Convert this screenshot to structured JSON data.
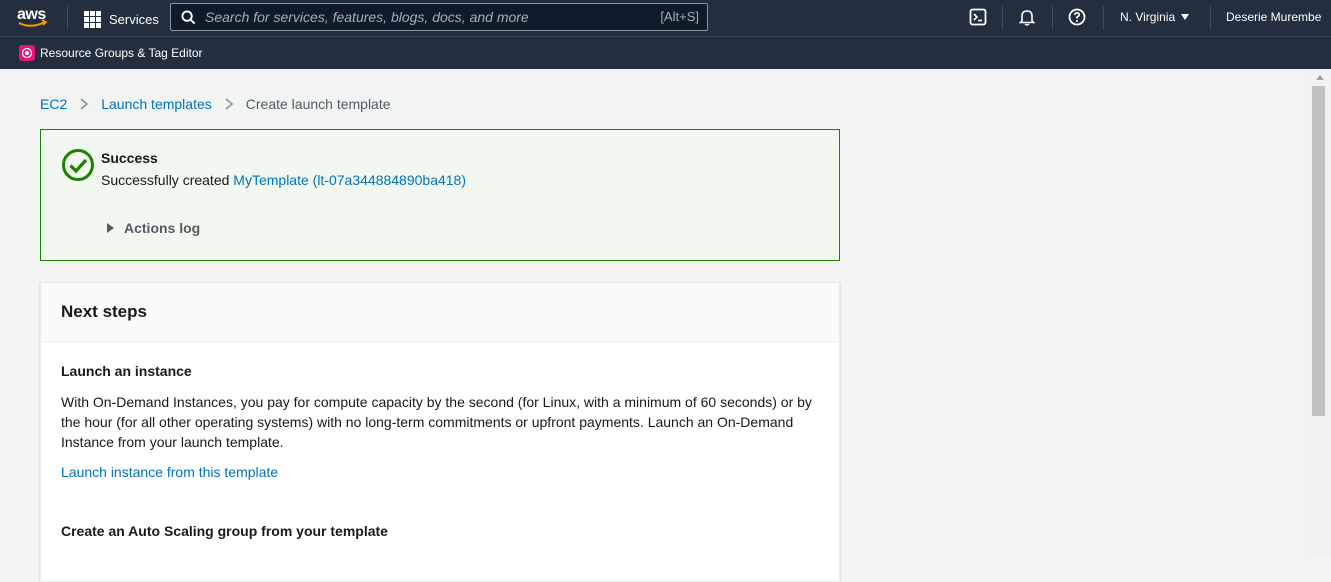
{
  "topbar": {
    "logo_text": "aws",
    "services_label": "Services",
    "search_placeholder": "Search for services, features, blogs, docs, and more",
    "search_shortcut": "[Alt+S]",
    "region": "N. Virginia",
    "user": "Deserie Murembe",
    "icons": [
      "cloudshell-icon",
      "bell-icon",
      "help-icon"
    ]
  },
  "subbar": {
    "resource_groups_label": "Resource Groups & Tag Editor"
  },
  "breadcrumb": {
    "items": [
      "EC2",
      "Launch templates",
      "Create launch template"
    ]
  },
  "alert": {
    "status": "success",
    "title": "Success",
    "message_prefix": "Successfully created",
    "template_link": "MyTemplate (lt-07a344884890ba418)",
    "actions_log_label": "Actions log",
    "color": "#1d8102"
  },
  "next_steps": {
    "title": "Next steps",
    "launch_title": "Launch an instance",
    "launch_body": "With On-Demand Instances, you pay for compute capacity by the second (for Linux, with a minimum of 60 seconds) or by the hour (for all other operating systems) with no long-term commitments or upfront payments. Launch an On-Demand Instance from your launch template.",
    "launch_link": "Launch instance from this template",
    "asg_title": "Create an Auto Scaling group from your template"
  },
  "colors": {
    "nav_bg": "#232f3e",
    "link": "#0073bb",
    "page_bg": "#f2f3f3"
  }
}
